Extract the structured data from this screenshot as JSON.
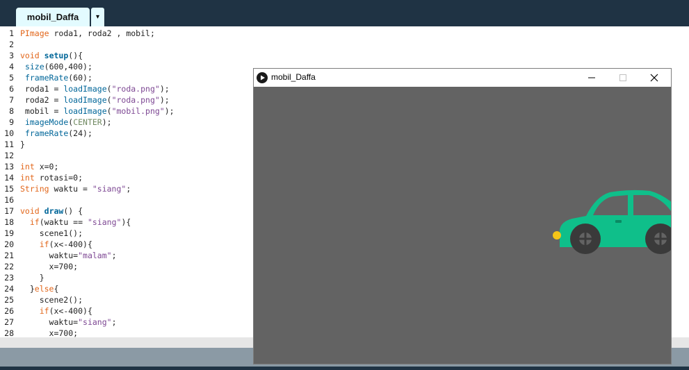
{
  "editor": {
    "tab_label": "mobil_Daffa",
    "tab_menu_glyph": "▾",
    "lines": [
      [
        {
          "t": "PImage",
          "c": "kw"
        },
        {
          "t": " roda1, roda2 , mobil;"
        }
      ],
      [],
      [
        {
          "t": "void",
          "c": "kw"
        },
        {
          "t": " "
        },
        {
          "t": "setup",
          "c": "fn"
        },
        {
          "t": "(){"
        }
      ],
      [
        {
          "t": " "
        },
        {
          "t": "size",
          "c": "call"
        },
        {
          "t": "(600,400);"
        }
      ],
      [
        {
          "t": " "
        },
        {
          "t": "frameRate",
          "c": "call"
        },
        {
          "t": "(60);"
        }
      ],
      [
        {
          "t": " roda1 = "
        },
        {
          "t": "loadImage",
          "c": "call"
        },
        {
          "t": "("
        },
        {
          "t": "\"roda.png\"",
          "c": "str"
        },
        {
          "t": ");"
        }
      ],
      [
        {
          "t": " roda2 = "
        },
        {
          "t": "loadImage",
          "c": "call"
        },
        {
          "t": "("
        },
        {
          "t": "\"roda.png\"",
          "c": "str"
        },
        {
          "t": ");"
        }
      ],
      [
        {
          "t": " mobil = "
        },
        {
          "t": "loadImage",
          "c": "call"
        },
        {
          "t": "("
        },
        {
          "t": "\"mobil.png\"",
          "c": "str"
        },
        {
          "t": ");"
        }
      ],
      [
        {
          "t": " "
        },
        {
          "t": "imageMode",
          "c": "call"
        },
        {
          "t": "("
        },
        {
          "t": "CENTER",
          "c": "const"
        },
        {
          "t": ");"
        }
      ],
      [
        {
          "t": " "
        },
        {
          "t": "frameRate",
          "c": "call"
        },
        {
          "t": "(24);"
        }
      ],
      [
        {
          "t": "}"
        }
      ],
      [],
      [
        {
          "t": "int",
          "c": "kw"
        },
        {
          "t": " x=0;"
        }
      ],
      [
        {
          "t": "int",
          "c": "kw"
        },
        {
          "t": " rotasi=0;"
        }
      ],
      [
        {
          "t": "String",
          "c": "kw"
        },
        {
          "t": " waktu = "
        },
        {
          "t": "\"siang\"",
          "c": "str"
        },
        {
          "t": ";"
        }
      ],
      [],
      [
        {
          "t": "void",
          "c": "kw"
        },
        {
          "t": " "
        },
        {
          "t": "draw",
          "c": "fn"
        },
        {
          "t": "() {"
        }
      ],
      [
        {
          "t": "  "
        },
        {
          "t": "if",
          "c": "kw"
        },
        {
          "t": "(waktu == "
        },
        {
          "t": "\"siang\"",
          "c": "str"
        },
        {
          "t": "){"
        }
      ],
      [
        {
          "t": "    scene1();"
        }
      ],
      [
        {
          "t": "    "
        },
        {
          "t": "if",
          "c": "kw"
        },
        {
          "t": "(x<-400){"
        }
      ],
      [
        {
          "t": "      waktu="
        },
        {
          "t": "\"malam\"",
          "c": "str"
        },
        {
          "t": ";"
        }
      ],
      [
        {
          "t": "      x=700;"
        }
      ],
      [
        {
          "t": "    }"
        }
      ],
      [
        {
          "t": "  }"
        },
        {
          "t": "else",
          "c": "kw"
        },
        {
          "t": "{"
        }
      ],
      [
        {
          "t": "    scene2();"
        }
      ],
      [
        {
          "t": "    "
        },
        {
          "t": "if",
          "c": "kw"
        },
        {
          "t": "(x<-400){"
        }
      ],
      [
        {
          "t": "      waktu="
        },
        {
          "t": "\"siang\"",
          "c": "str"
        },
        {
          "t": ";"
        }
      ],
      [
        {
          "t": "      x=700;"
        }
      ]
    ]
  },
  "sketch_window": {
    "title": "mobil_Daffa",
    "icon": "processing-play-icon",
    "controls": [
      "minimize-icon",
      "maximize-icon",
      "close-icon"
    ],
    "canvas_background": "#636363",
    "car_color": "#0fbf8a",
    "wheel_color": "#3a3a3a",
    "light_color": "#f5c518"
  }
}
